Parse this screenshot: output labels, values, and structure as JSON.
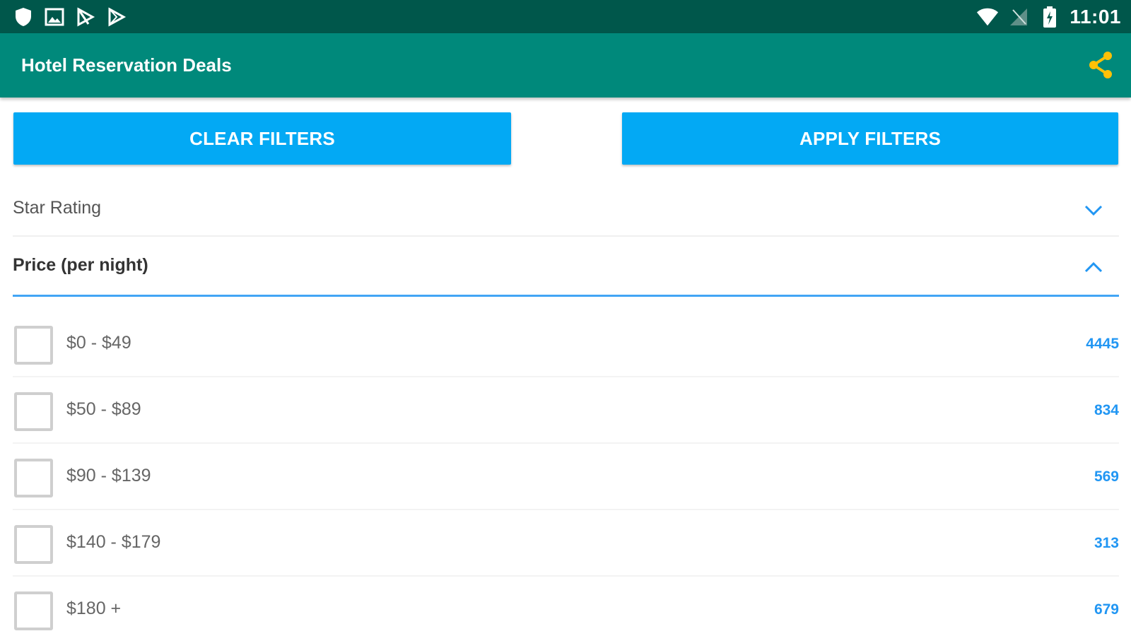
{
  "status_bar": {
    "time": "11:01",
    "left_icons": [
      "shield-icon",
      "image-icon",
      "play-store-flag-icon",
      "play-store-icon"
    ],
    "right_icons": [
      "wifi-icon",
      "no-signal-icon",
      "battery-icon"
    ]
  },
  "app_bar": {
    "title": "Hotel Reservation Deals",
    "share_icon": "share-icon",
    "share_color": "#ffc107"
  },
  "actions": {
    "clear_label": "CLEAR FILTERS",
    "apply_label": "APPLY FILTERS"
  },
  "filters": {
    "star_rating": {
      "label": "Star Rating",
      "expanded": false,
      "chevron_icon": "chevron-down-icon"
    },
    "price": {
      "label": "Price (per night)",
      "expanded": true,
      "chevron_icon": "chevron-up-icon",
      "options": [
        {
          "range": "$0 - $49",
          "count": "4445",
          "checked": false
        },
        {
          "range": "$50 - $89",
          "count": "834",
          "checked": false
        },
        {
          "range": "$90 - $139",
          "count": "569",
          "checked": false
        },
        {
          "range": "$140 - $179",
          "count": "313",
          "checked": false
        },
        {
          "range": "$180 +",
          "count": "679",
          "checked": false
        }
      ]
    }
  },
  "colors": {
    "status_bar": "#00574b",
    "app_bar": "#00897b",
    "button": "#03a9f4",
    "accent_line": "#42a5f5",
    "count": "#2196f3"
  }
}
